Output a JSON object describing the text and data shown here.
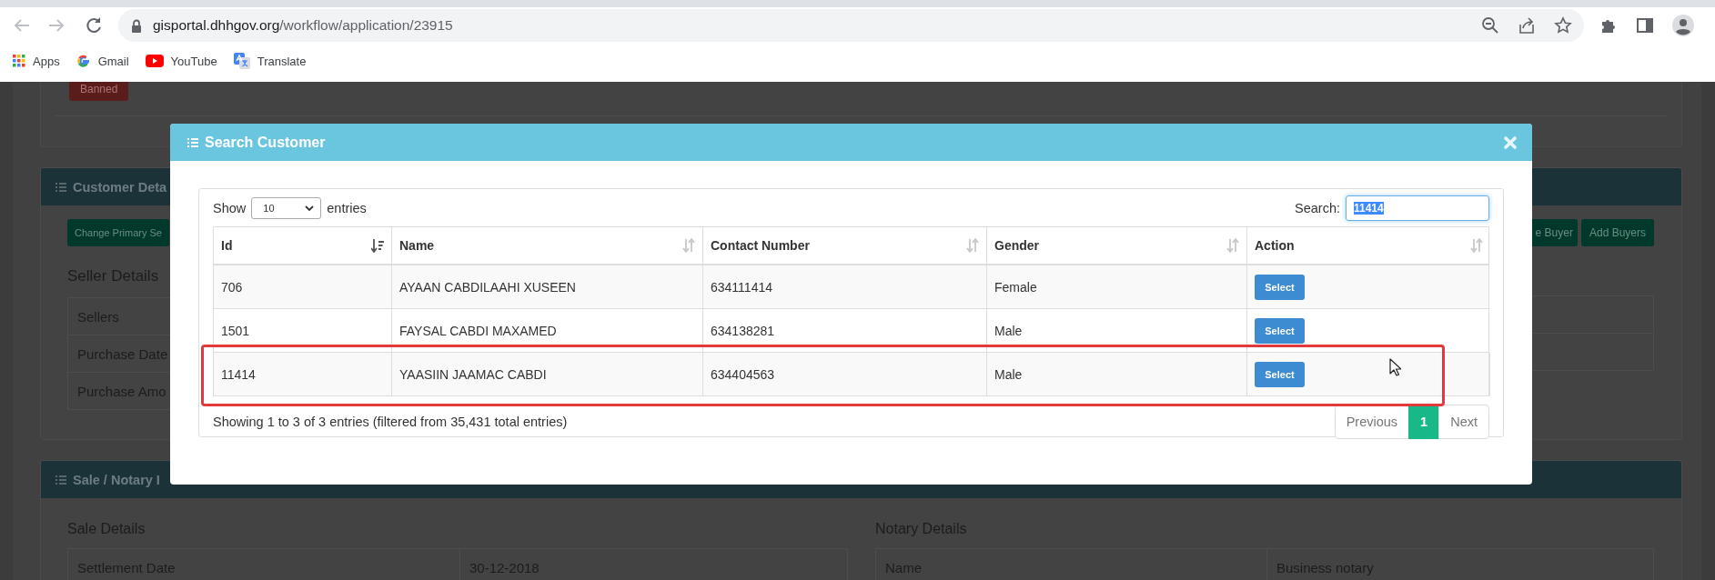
{
  "browser": {
    "url_host": "gisportal.dhhgov.org",
    "url_path": "/workflow/application/23915",
    "bookmarks": [
      {
        "kind": "apps",
        "label": "Apps"
      },
      {
        "kind": "google",
        "label": "Gmail"
      },
      {
        "kind": "youtube",
        "label": "YouTube"
      },
      {
        "kind": "translate",
        "label": "Translate"
      }
    ]
  },
  "page": {
    "status_button": "Banned",
    "customer_panel": {
      "title": "Customer Deta",
      "left_button": "Change Primary Se",
      "right_buttons": [
        "e Buyer",
        "Add Buyers"
      ],
      "seller_heading": "Seller Details",
      "seller_rows": [
        "Sellers",
        "Purchase Date",
        "Purchase Amo"
      ]
    },
    "sale_panel": {
      "title": "Sale / Notary I",
      "sale_heading": "Sale Details",
      "sale_rows": [
        {
          "label": "Settlement Date",
          "value": "30-12-2018"
        }
      ],
      "notary_heading": "Notary Details",
      "notary_rows": [
        {
          "label": "Name",
          "value": "Business notary"
        }
      ]
    }
  },
  "modal": {
    "title": "Search Customer",
    "show_label": "Show",
    "page_length": "10",
    "entries_label": "entries",
    "search_label": "Search:",
    "search_value": "11414",
    "search_text_selected": true,
    "columns": [
      {
        "label": "Id",
        "sorted": true
      },
      {
        "label": "Name",
        "sorted": false
      },
      {
        "label": "Contact Number",
        "sorted": false
      },
      {
        "label": "Gender",
        "sorted": false
      },
      {
        "label": "Action",
        "sorted": false
      }
    ],
    "rows": [
      {
        "id": "706",
        "name": "AYAAN CABDILAAHI XUSEEN",
        "contact": "634111414",
        "gender": "Female",
        "action": "Select",
        "highlighted": false
      },
      {
        "id": "1501",
        "name": "FAYSAL CABDI MAXAMED",
        "contact": "634138281",
        "gender": "Male",
        "action": "Select",
        "highlighted": false
      },
      {
        "id": "11414",
        "name": "YAASIIN JAAMAC CABDI",
        "contact": "634404563",
        "gender": "Male",
        "action": "Select",
        "highlighted": true
      }
    ],
    "info": "Showing 1 to 3 of 3 entries (filtered from 35,431 total entries)",
    "pagination": [
      {
        "label": "Previous",
        "selected": false
      },
      {
        "label": "1",
        "selected": true
      },
      {
        "label": "Next",
        "selected": false
      }
    ]
  }
}
